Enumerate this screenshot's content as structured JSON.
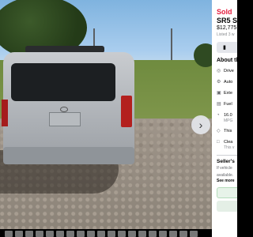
{
  "listing": {
    "status": "Sold",
    "title": "SR5 S",
    "price": "$12,775",
    "listed": "Listed 3 w",
    "save_icon": "bookmark-icon"
  },
  "about": {
    "heading": "About th",
    "specs": [
      {
        "icon": "steering-wheel-icon",
        "text": "Drive"
      },
      {
        "icon": "gear-icon",
        "text": "Auto"
      },
      {
        "icon": "car-icon",
        "text": "Exte"
      },
      {
        "icon": "fuel-pump-icon",
        "text": "Fuel"
      },
      {
        "icon": "gauge-icon",
        "text": "16.0",
        "sub": "MPG"
      },
      {
        "icon": "tag-icon",
        "text": "This"
      },
      {
        "icon": "document-icon",
        "text": "Clea",
        "sub": "This v"
      }
    ]
  },
  "seller": {
    "heading": "Seller's",
    "text1": "If vehicle",
    "text2": "available.",
    "see_more": "See more"
  },
  "colors": {
    "sold": "#e41e3f",
    "panel_bg": "#ffffff",
    "photo_bg": "#000000"
  }
}
